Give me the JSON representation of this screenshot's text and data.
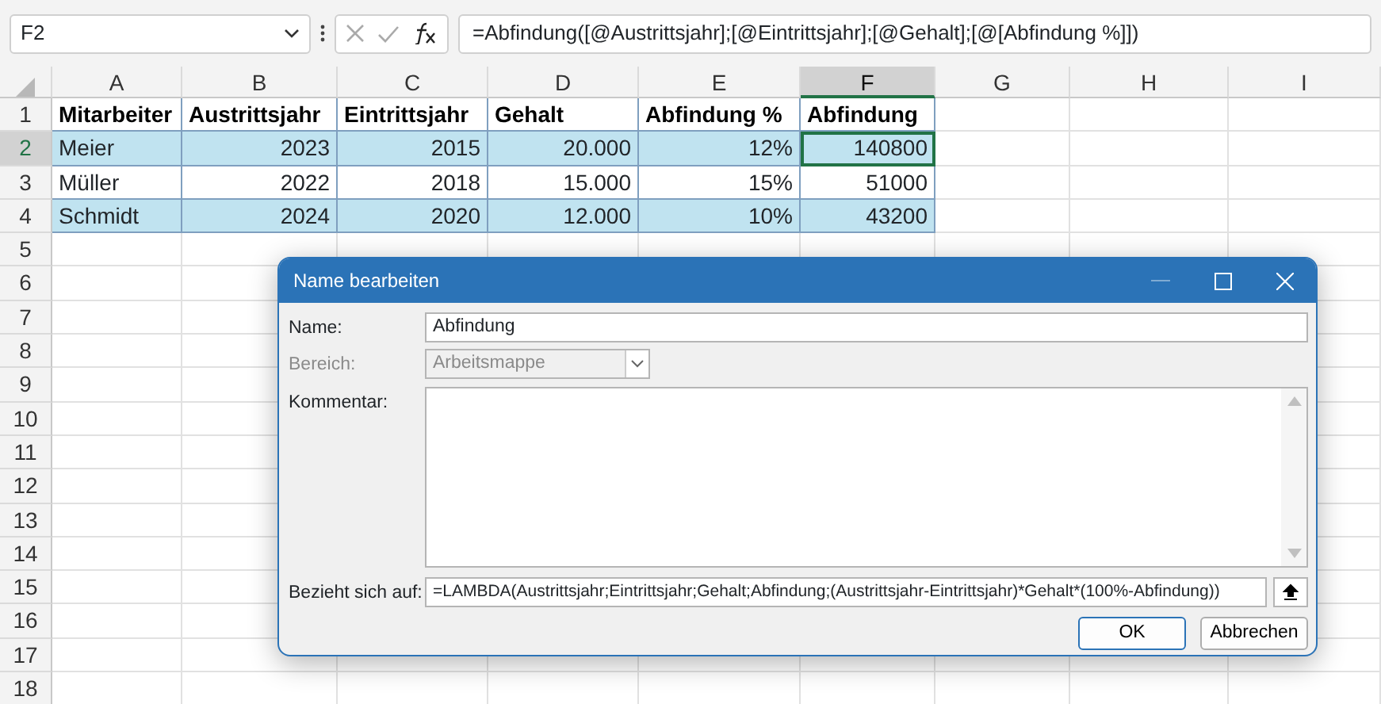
{
  "name_box": "F2",
  "formula": "=Abfindung([@Austrittsjahr];[@Eintrittsjahr];[@Gehalt];[@[Abfindung %]])",
  "columns": [
    {
      "label": "A",
      "selected": false
    },
    {
      "label": "B",
      "selected": false
    },
    {
      "label": "C",
      "selected": false
    },
    {
      "label": "D",
      "selected": false
    },
    {
      "label": "E",
      "selected": false
    },
    {
      "label": "F",
      "selected": true
    },
    {
      "label": "G",
      "selected": false
    },
    {
      "label": "H",
      "selected": false
    },
    {
      "label": "I",
      "selected": false
    }
  ],
  "rows": [
    {
      "number": "1",
      "selected": false,
      "kind": "header",
      "banded": false,
      "cells": [
        "Mitarbeiter",
        "Austrittsjahr",
        "Eintrittsjahr",
        "Gehalt",
        "Abfindung %",
        "Abfindung"
      ]
    },
    {
      "number": "2",
      "selected": true,
      "kind": "data",
      "banded": true,
      "cells": [
        "Meier",
        "2023",
        "2015",
        "20.000",
        "12%",
        "140800"
      ]
    },
    {
      "number": "3",
      "selected": false,
      "kind": "data",
      "banded": false,
      "cells": [
        "Müller",
        "2022",
        "2018",
        "15.000",
        "15%",
        "51000"
      ]
    },
    {
      "number": "4",
      "selected": false,
      "kind": "data",
      "banded": true,
      "cells": [
        "Schmidt",
        "2024",
        "2020",
        "12.000",
        "10%",
        "43200"
      ]
    }
  ],
  "empty_rows": [
    "5",
    "6",
    "7",
    "8",
    "9",
    "10",
    "11",
    "12",
    "13",
    "14",
    "15",
    "16",
    "17",
    "18"
  ],
  "dialog": {
    "title": "Name bearbeiten",
    "name": {
      "label": "Name:",
      "value": "Abfindung"
    },
    "scope": {
      "label": "Bereich:",
      "value": "Arbeitsmappe",
      "disabled": true
    },
    "comment": {
      "label": "Kommentar:"
    },
    "refers_to": {
      "label": "Bezieht sich auf:",
      "value": "=LAMBDA(Austrittsjahr;Eintrittsjahr;Gehalt;Abfindung;(Austrittsjahr-Eintrittsjahr)*Gehalt*(100%-Abfindung))"
    },
    "buttons": [
      {
        "label": "OK",
        "default": true
      },
      {
        "label": "Abbrechen",
        "default": false
      }
    ]
  }
}
